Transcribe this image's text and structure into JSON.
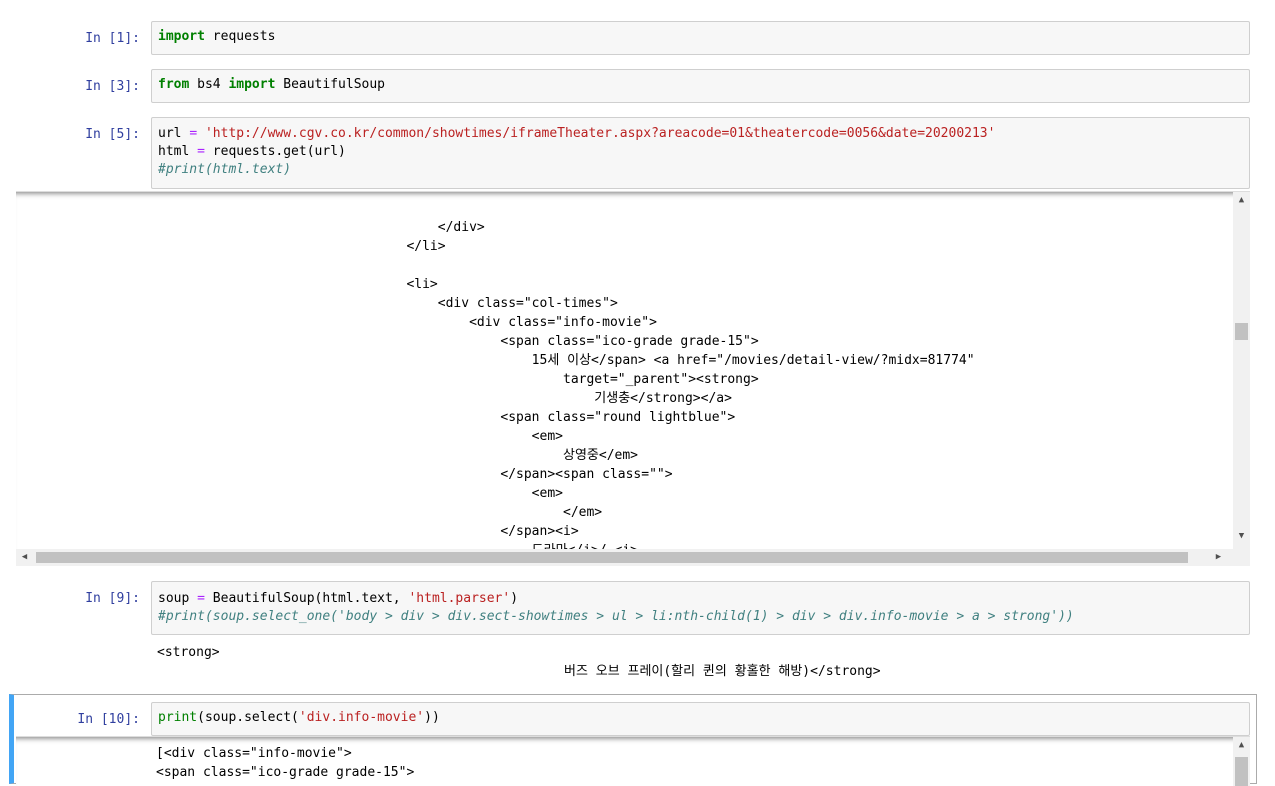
{
  "cells": [
    {
      "prompt": "In [1]:",
      "tokens": [
        {
          "t": "import",
          "c": "kw"
        },
        {
          "t": " requests",
          "c": ""
        }
      ]
    },
    {
      "prompt": "In [3]:",
      "tokens": [
        {
          "t": "from",
          "c": "kw"
        },
        {
          "t": " bs4 ",
          "c": ""
        },
        {
          "t": "import",
          "c": "kw"
        },
        {
          "t": " BeautifulSoup",
          "c": ""
        }
      ]
    },
    {
      "prompt": "In [5]:",
      "lines": [
        [
          {
            "t": "url ",
            "c": ""
          },
          {
            "t": "=",
            "c": "op"
          },
          {
            "t": " ",
            "c": ""
          },
          {
            "t": "'http://www.cgv.co.kr/common/showtimes/iframeTheater.aspx?areacode=01&theatercode=0056&date=20200213'",
            "c": "str"
          }
        ],
        [
          {
            "t": "html ",
            "c": ""
          },
          {
            "t": "=",
            "c": "op"
          },
          {
            "t": " requests.get(url)",
            "c": ""
          }
        ],
        [
          {
            "t": "#print(html.text)",
            "c": "cm"
          }
        ]
      ]
    },
    {
      "prompt": "In [9]:",
      "lines": [
        [
          {
            "t": "soup ",
            "c": ""
          },
          {
            "t": "=",
            "c": "op"
          },
          {
            "t": " BeautifulSoup(html.text, ",
            "c": ""
          },
          {
            "t": "'html.parser'",
            "c": "str"
          },
          {
            "t": ")",
            "c": ""
          }
        ],
        [
          {
            "t": "#print(soup.select_one('body > div > div.sect-showtimes > ul > li:nth-child(1) > div > div.info-movie > a > strong'))",
            "c": "cm"
          }
        ]
      ]
    },
    {
      "prompt": "In [10]:",
      "lines": [
        [
          {
            "t": "print",
            "c": "bi"
          },
          {
            "t": "(soup.select(",
            "c": ""
          },
          {
            "t": "'div.info-movie'",
            "c": "str"
          },
          {
            "t": "))",
            "c": ""
          }
        ]
      ]
    }
  ],
  "output5": [
    "                                    </div>",
    "                                </li>",
    "",
    "                                <li>",
    "                                    <div class=\"col-times\">",
    "                                        <div class=\"info-movie\">",
    "                                            <span class=\"ico-grade grade-15\">",
    "                                                15세 이상</span> <a href=\"/movies/detail-view/?midx=81774\"",
    "                                                    target=\"_parent\"><strong>",
    "                                                        기생충</strong></a>",
    "                                            <span class=\"round lightblue\">",
    "                                                <em>",
    "                                                    상영중</em>",
    "                                            </span><span class=\"\">",
    "                                                <em>",
    "                                                    </em>",
    "                                            </span><i>",
    "                                                드라마</i>/ <i>"
  ],
  "output9": [
    "<strong>",
    "                                                    버즈 오브 프레이(할리 퀸의 황홀한 해방)</strong>"
  ],
  "output10": [
    "[<div class=\"info-movie\">",
    "<span class=\"ico-grade grade-15\">"
  ]
}
